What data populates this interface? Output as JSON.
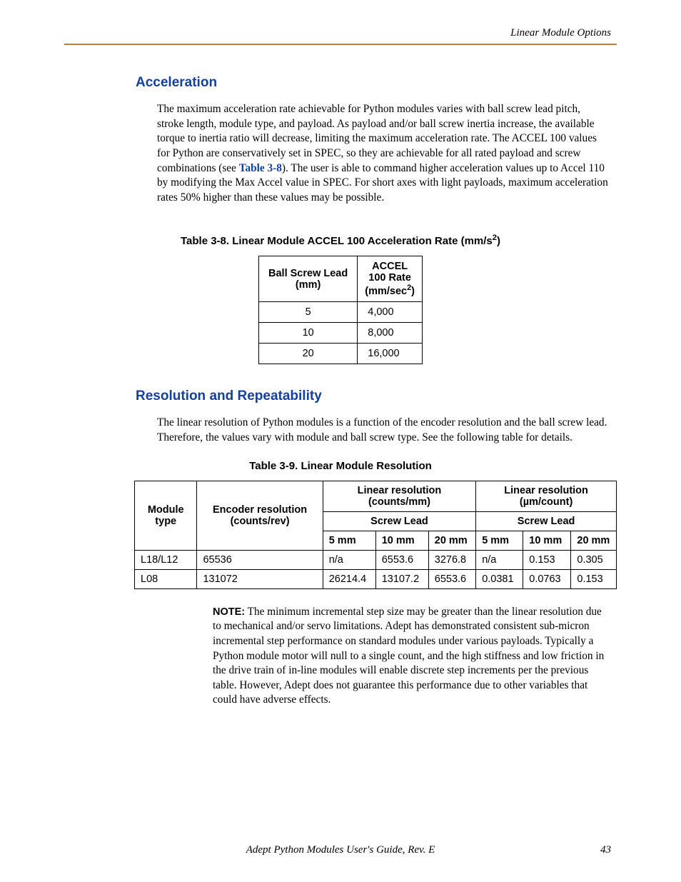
{
  "running_head": "Linear Module Options",
  "section1": {
    "heading": "Acceleration",
    "para_before": "The maximum acceleration rate achievable for Python modules varies with ball screw lead pitch, stroke length, module type, and payload. As payload and/or ball screw inertia increase, the available torque to inertia ratio will decrease, limiting the maximum acceleration rate. The ACCEL 100 values for Python are conservatively set in SPEC, so they are achievable for all rated payload and screw combinations (see ",
    "xref": "Table 3-8",
    "para_after": "). The user is able to command higher acceleration values up to Accel 110 by modifying the Max Accel value in SPEC. For short axes with light payloads, maximum acceleration rates 50% higher than these values may be possible."
  },
  "table38": {
    "caption_pre": "Table 3-8. Linear Module ACCEL 100 Acceleration Rate (mm/s",
    "caption_sup": "2",
    "caption_post": ")",
    "h1": "Ball Screw Lead (mm)",
    "h2_line1": "ACCEL",
    "h2_line2": "100 Rate",
    "h2_line3_pre": "(mm/sec",
    "h2_line3_sup": "2",
    "h2_line3_post": ")",
    "rows": [
      {
        "lead": "5",
        "rate": "4,000"
      },
      {
        "lead": "10",
        "rate": "8,000"
      },
      {
        "lead": "20",
        "rate": "16,000"
      }
    ]
  },
  "section2": {
    "heading": "Resolution and Repeatability",
    "para": "The linear resolution of Python modules is a function of the encoder resolution and the ball screw lead. Therefore, the values vary with module and ball screw type. See the following table for details."
  },
  "table39": {
    "caption": "Table 3-9. Linear Module Resolution",
    "h_module": "Module type",
    "h_encoder": "Encoder resolution (counts/rev)",
    "h_group1": "Linear resolution (counts/mm)",
    "h_group2": "Linear resolution (µm/count)",
    "h_screw": "Screw Lead",
    "h_5": "5 mm",
    "h_10": "10 mm",
    "h_20": "20 mm",
    "rows": [
      {
        "module": "L18/L12",
        "enc": "65536",
        "c5": "n/a",
        "c10": "6553.6",
        "c20": "3276.8",
        "u5": "n/a",
        "u10": "0.153",
        "u20": "0.305"
      },
      {
        "module": "L08",
        "enc": "131072",
        "c5": "26214.4",
        "c10": "13107.2",
        "c20": "6553.6",
        "u5": "0.0381",
        "u10": "0.0763",
        "u20": "0.153"
      }
    ]
  },
  "note": {
    "label": "NOTE:",
    "text": " The minimum incremental step size may be greater than the linear resolution due to mechanical and/or servo limitations. Adept has demonstrated consistent sub-micron incremental step performance on standard modules under various payloads. Typically a Python module motor will null to a single count, and the high stiffness and low friction in the drive train of in-line modules will enable discrete step increments per the previous table. However, Adept does not guarantee this performance due to other variables that could have adverse effects."
  },
  "footer": {
    "title": "Adept Python Modules User's Guide, Rev. E",
    "page": "43"
  }
}
